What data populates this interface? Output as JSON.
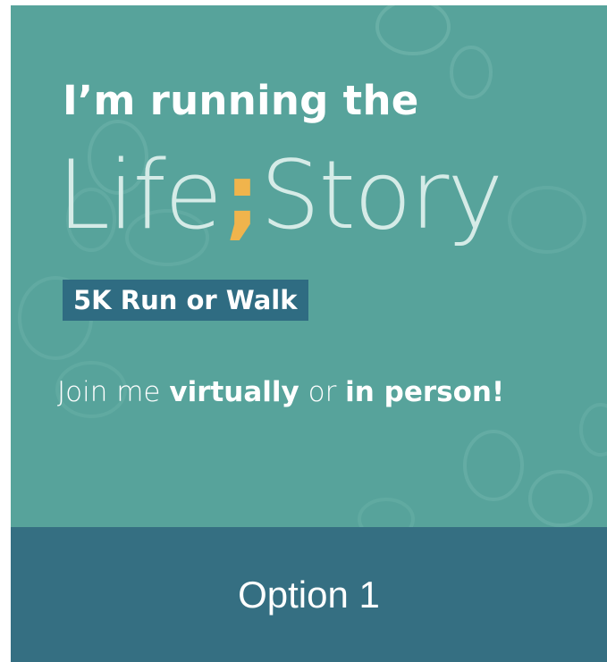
{
  "poster": {
    "headline": "I’m running the",
    "logo": {
      "word_1": "Life",
      "separator": ";",
      "word_2": "Story"
    },
    "event_badge": "5K Run or Walk",
    "tagline": {
      "part_1": "Join me ",
      "emphasis_1": "virtually",
      "part_2": " or ",
      "emphasis_2": "in person!"
    }
  },
  "footer": {
    "label": "Option 1"
  },
  "colors": {
    "poster_background": "#57a39b",
    "logo_text": "#d5ebe7",
    "semicolon_accent": "#f0b44c",
    "badge_background": "#2f6c82",
    "footer_background": "#356f82"
  }
}
